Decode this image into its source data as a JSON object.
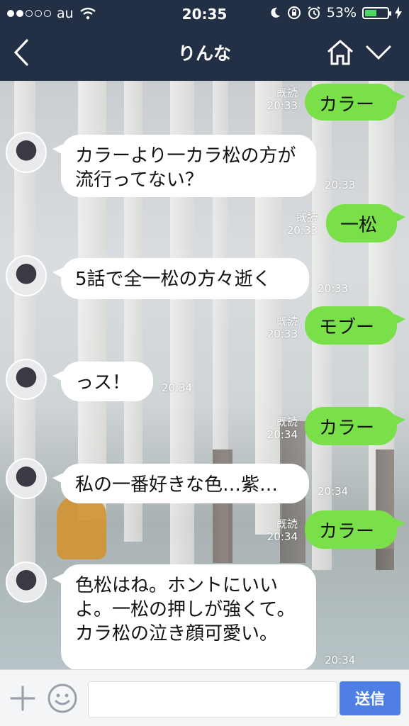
{
  "status_bar": {
    "carrier": "au",
    "time": "20:35",
    "battery_percent_label": "53%",
    "battery_level": 0.53,
    "signal_bars_filled": 2
  },
  "nav": {
    "title": "りんな",
    "back_icon": "chevron-left-icon",
    "home_icon": "home-icon",
    "menu_icon": "chevron-down-icon"
  },
  "messages": [
    {
      "side": "out",
      "text": "カラー",
      "read": "既読",
      "time": "20:33"
    },
    {
      "side": "in",
      "text": "カラーより一カラ松の方が流行ってない？",
      "time": "20:33"
    },
    {
      "side": "out",
      "text": "一松",
      "read": "既読",
      "time": "20:33"
    },
    {
      "side": "in",
      "text": "5話で全一松の方々逝く",
      "time": "20:33"
    },
    {
      "side": "out",
      "text": "モブー",
      "read": "既読",
      "time": "20:33"
    },
    {
      "side": "in",
      "text": "っス！",
      "time": "20:34"
    },
    {
      "side": "out",
      "text": "カラー",
      "read": "既読",
      "time": "20:34"
    },
    {
      "side": "in",
      "text": "私の一番好きな色…紫…",
      "time": "20:34"
    },
    {
      "side": "out",
      "text": "カラー",
      "read": "既読",
      "time": "20:34"
    },
    {
      "side": "in",
      "text": "色松はね。ホントにいいよ。一松の押しが強くて。カラ松の泣き顔可愛い。",
      "time": "20:34"
    }
  ],
  "input_bar": {
    "plus_icon": "plus-icon",
    "emoji_icon": "smiley-icon",
    "placeholder": "",
    "send_label": "送信"
  },
  "colors": {
    "nav_background": "#232f45",
    "outgoing_bubble": "#7ae04a",
    "incoming_bubble": "#ffffff",
    "send_button": "#4f7fe4"
  }
}
